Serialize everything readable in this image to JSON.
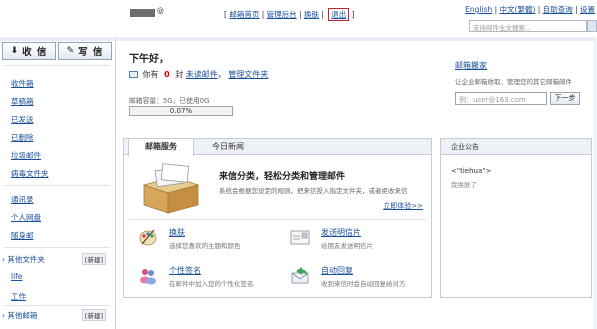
{
  "topbar": {
    "user_suffix": "@",
    "nav": {
      "open_bracket": "[",
      "home": "邮箱首页",
      "sep": "|",
      "admin": "管理后台",
      "skin": "换肤",
      "logout": "退出",
      "close_bracket": "]"
    },
    "right_links": [
      "English",
      "中文(繁體)",
      "自助查询",
      "设置"
    ],
    "search_placeholder": "支持邮件全文搜索..."
  },
  "sidebar": {
    "receive_label": "收 信",
    "write_label": "写 信",
    "mail_items": [
      "收件箱",
      "草稿箱",
      "已发送",
      "已删除",
      "垃圾邮件",
      "病毒文件夹"
    ],
    "tool_items": [
      "通讯录",
      "个人网盘",
      "随身邮"
    ],
    "other_folders": "其他文件夹",
    "new_label": "[新建]",
    "folders": [
      "life",
      "工作"
    ],
    "other_mailboxes": "其他邮箱"
  },
  "main": {
    "greeting": "下午好，",
    "unread": {
      "prefix": "你有",
      "count": "0",
      "unit": "封",
      "link": "未读邮件",
      "comma": "，",
      "manage": "管理文件夹"
    },
    "quota_text": "邮箱容量：5G，已使用0G",
    "quota_percent": "0.07%",
    "quota_fraction": 0.0007
  },
  "tips": {
    "title": "邮箱搬家",
    "text": "让企业邮箱收取、管理您的其它邮箱邮件",
    "input_placeholder": "例：user@163.com",
    "next_label": "下一步"
  },
  "panel": {
    "tabs": [
      "邮箱服务",
      "今日新闻"
    ],
    "feature_title": "来信分类，轻松分类和管理邮件",
    "feature_desc": "系统会根据您设定的规则，把来信投入指定文件夹，或者拒收来信",
    "feature_try": "立即体验>>",
    "services": [
      {
        "title": "换肤",
        "desc": "选择您喜欢的主题和颜色",
        "icon": "palette-icon"
      },
      {
        "title": "发送明信片",
        "desc": "给朋友发送明信片",
        "icon": "postcard-icon"
      },
      {
        "title": "个性签名",
        "desc": "在邮件中加入您的个性化签名",
        "icon": "people-icon"
      },
      {
        "title": "自动回复",
        "desc": "收到来信时会自动回复给对方",
        "icon": "auto-reply-icon"
      }
    ]
  },
  "notice": {
    "title": "企业公告",
    "line1": "<\"tiehua\">",
    "line2": "我换肤了"
  },
  "colors": {
    "link": "#1a4f9c",
    "accent_bg": "#eef2f7",
    "unread_count": "#d30000"
  }
}
